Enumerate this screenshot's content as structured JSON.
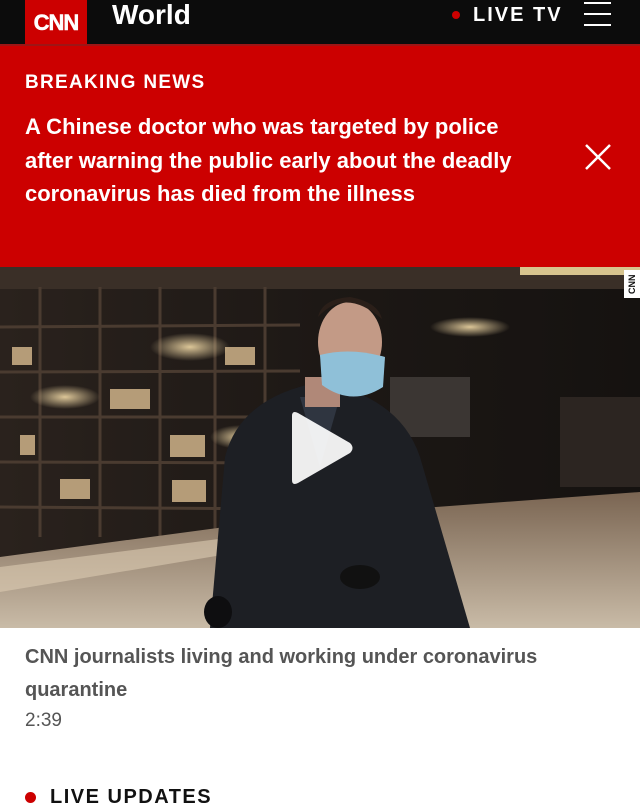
{
  "header": {
    "logo_text": "CNN",
    "section_title": "World",
    "live_tv_label": "LIVE TV",
    "menu_icon": "hamburger-menu-icon"
  },
  "breaking_news": {
    "label": "BREAKING NEWS",
    "headline": "A Chinese doctor who was targeted by police after warning the public early about the deadly coronavirus has died from the illness",
    "close_icon": "close-icon"
  },
  "video": {
    "watermark": "CNN",
    "play_icon": "play-icon",
    "title": "CNN journalists living and working under coronavirus quarantine",
    "duration": "2:39"
  },
  "live_updates": {
    "label": "LIVE UPDATES"
  },
  "colors": {
    "brand_red": "#cc0000",
    "header_black": "#0c0c0c"
  }
}
